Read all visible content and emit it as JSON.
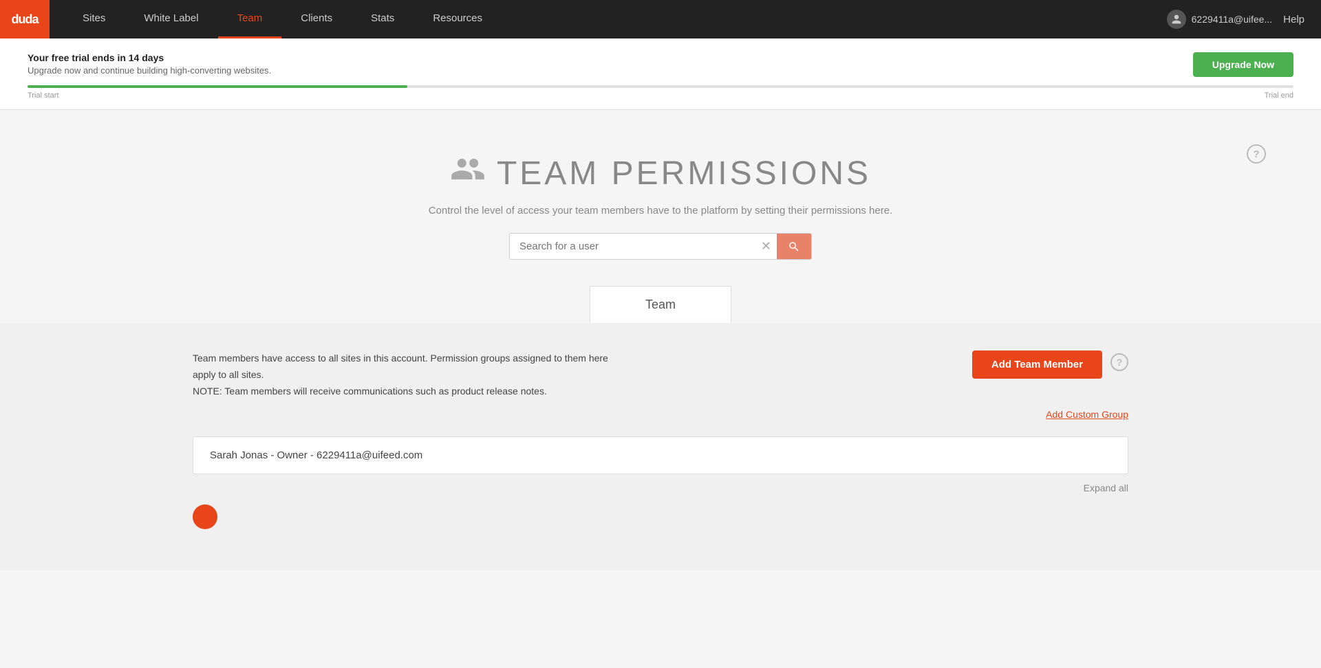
{
  "brand": {
    "logo_text": "duda"
  },
  "nav": {
    "links": [
      {
        "label": "Sites",
        "active": false
      },
      {
        "label": "White Label",
        "active": false
      },
      {
        "label": "Team",
        "active": true
      },
      {
        "label": "Clients",
        "active": false
      },
      {
        "label": "Stats",
        "active": false
      },
      {
        "label": "Resources",
        "active": false
      }
    ],
    "user_email": "6229411a@uifee...",
    "help_label": "Help"
  },
  "trial_banner": {
    "title": "Your free trial ends in 14 days",
    "subtitle": "Upgrade now and continue building high-converting websites.",
    "trial_start_label": "Trial start",
    "trial_end_label": "Trial end",
    "upgrade_btn_label": "Upgrade Now"
  },
  "page": {
    "icon": "👤",
    "title": "TEAM PERMISSIONS",
    "subtitle": "Control the level of access your team members have to the platform by setting their permissions here.",
    "search_placeholder": "Search for a user",
    "tab_label": "Team",
    "team_info": "Team members have access to all sites in this account. Permission groups assigned to them here apply to all sites.\nNOTE: Team members will receive communications such as product release notes.",
    "add_team_btn": "Add Team Member",
    "add_custom_group_link": "Add Custom Group",
    "member_label": "Sarah Jonas - Owner - 6229411a@uifeed.com",
    "expand_all_label": "Expand all"
  }
}
